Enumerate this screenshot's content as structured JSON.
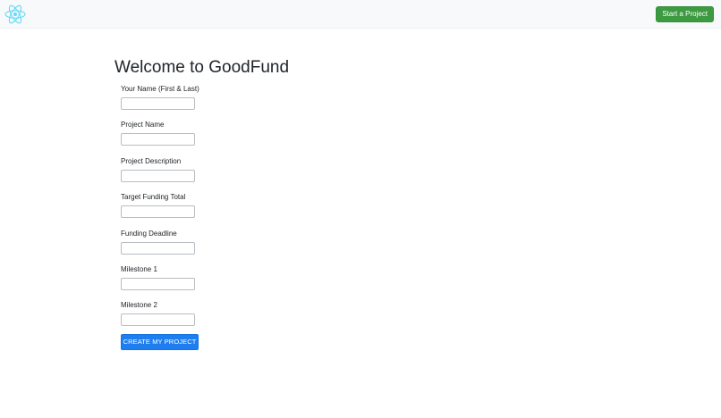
{
  "navbar": {
    "logo_icon": "react-atom-icon",
    "logo_color": "#61dafb",
    "start_button_label": "Start a Project",
    "start_button_color": "#3c9a41"
  },
  "main": {
    "title": "Welcome to GoodFund",
    "fields": [
      {
        "label": "Your Name (First & Last)",
        "value": "",
        "placeholder": ""
      },
      {
        "label": "Project Name",
        "value": "",
        "placeholder": ""
      },
      {
        "label": "Project Description",
        "value": "",
        "placeholder": ""
      },
      {
        "label": "Target Funding Total",
        "value": "",
        "placeholder": ""
      },
      {
        "label": "Funding Deadline",
        "value": "",
        "placeholder": ""
      },
      {
        "label": "Milestone 1",
        "value": "",
        "placeholder": ""
      },
      {
        "label": "Milestone 2",
        "value": "",
        "placeholder": ""
      }
    ],
    "submit_label": "CREATE MY PROJECT",
    "submit_color": "#1e7ef0"
  }
}
